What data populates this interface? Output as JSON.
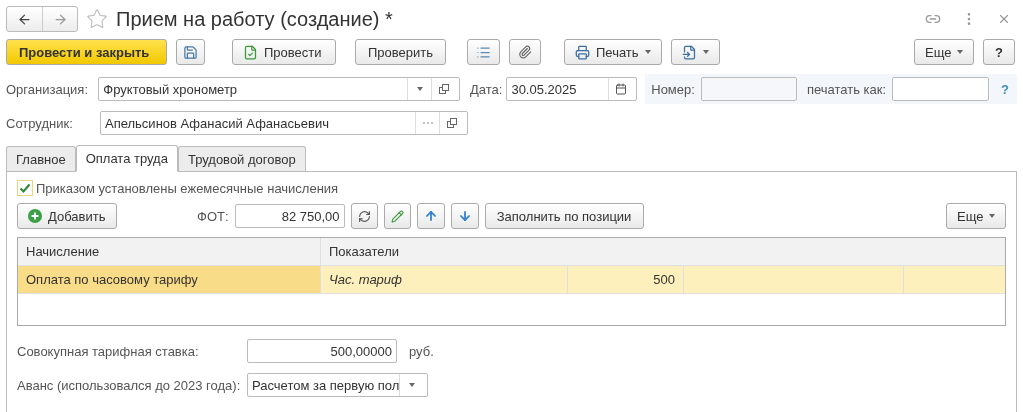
{
  "window": {
    "title": "Прием на работу (создание) *"
  },
  "toolbar": [
    {
      "kind": "primary",
      "label": "Провести и закрыть"
    },
    {
      "kind": "save"
    },
    {
      "kind": "post",
      "label": "Провести"
    },
    {
      "kind": "text",
      "label": "Проверить"
    },
    {
      "kind": "list"
    },
    {
      "kind": "clip"
    },
    {
      "kind": "print",
      "label": "Печать"
    },
    {
      "kind": "export"
    },
    {
      "kind": "spacer"
    },
    {
      "kind": "more",
      "label": "Еще"
    },
    {
      "kind": "help",
      "label": "?"
    }
  ],
  "header": {
    "organization": {
      "label": "Организация:",
      "value": "Фруктовый хронометр"
    },
    "date": {
      "label": "Дата:",
      "value": "30.05.2025"
    },
    "number": {
      "label": "Номер:"
    },
    "print_as": {
      "label": "печатать как:",
      "help": "?"
    },
    "employee": {
      "label": "Сотрудник:",
      "value": "Апельсинов Афанасий Афанасьевич"
    }
  },
  "tabs": [
    {
      "label": "Главное",
      "selected": false
    },
    {
      "label": "Оплата труда",
      "selected": true
    },
    {
      "label": "Трудовой договор",
      "selected": false
    }
  ],
  "monthly_accruals": {
    "label": "Приказом установлены ежемесячные начисления",
    "checked": true
  },
  "payroll_toolbar": {
    "add": "Добавить",
    "fot_label": "ФОТ:",
    "fot_value": "82 750,00",
    "fill": "Заполнить по позиции",
    "more": "Еще"
  },
  "table": {
    "columns": [
      "Начисление",
      "Показатели"
    ],
    "rows": [
      {
        "selected": true,
        "accrual": "Оплата по часовому тарифу",
        "indicator": "Час. тариф",
        "value": "500"
      }
    ]
  },
  "total_rate": {
    "label": "Совокупная тарифная ставка:",
    "value": "500,00000",
    "unit": "руб."
  },
  "advance": {
    "label": "Аванс (использовался до 2023 года):",
    "value": "Расчетом за первую пол"
  }
}
